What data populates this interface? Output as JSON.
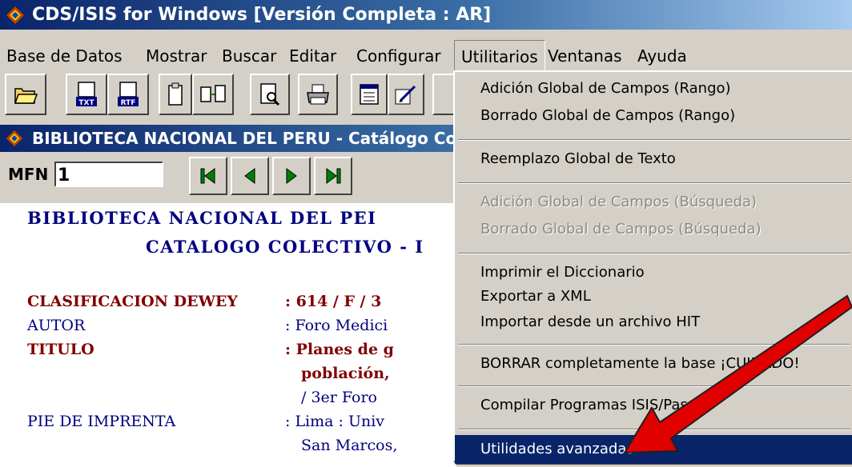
{
  "window": {
    "title": "CDS/ISIS for Windows [Versión Completa : AR]"
  },
  "menubar": {
    "items": [
      "Base de Datos",
      "Mostrar",
      "Buscar",
      "Editar",
      "Configurar",
      "Utilitarios",
      "Ventanas",
      "Ayuda"
    ],
    "open_item": "Utilitarios"
  },
  "toolbar": {
    "buttons": [
      {
        "icon": "open-folder-icon",
        "label": ""
      },
      {
        "icon": "export-txt-icon",
        "label": "TXT"
      },
      {
        "icon": "export-rtf-icon",
        "label": "RTF"
      },
      {
        "icon": "clipboard-icon",
        "label": ""
      },
      {
        "icon": "copy-record-icon",
        "label": ""
      },
      {
        "icon": "print-preview-icon",
        "label": ""
      },
      {
        "icon": "print-icon",
        "label": ""
      },
      {
        "icon": "form-icon",
        "label": ""
      },
      {
        "icon": "edit-pen-icon",
        "label": ""
      }
    ]
  },
  "child_window": {
    "title": "BIBLIOTECA NACIONAL DEL PERU - Catálogo Co",
    "mfn_label": "MFN",
    "mfn_value": "1",
    "nav": [
      "first-record-icon",
      "previous-record-icon",
      "next-record-icon",
      "last-record-icon"
    ],
    "record": {
      "header1": "BIBLIOTECA NACIONAL DEL PEI",
      "header2": "CATALOGO COLECTIVO - I",
      "fields": [
        {
          "label": "CLASIFICACION DEWEY",
          "value": ": 614 / F / 3"
        },
        {
          "label": "AUTOR",
          "value": ": Foro Medici"
        },
        {
          "label": "TITULO",
          "value": ": Planes de g"
        },
        {
          "label": "",
          "value": "población,"
        },
        {
          "label": "",
          "value": "/ 3er Foro"
        },
        {
          "label": "PIE DE IMPRENTA",
          "value": ": Lima : Univ"
        },
        {
          "label": "",
          "value": "San Marcos,"
        }
      ]
    }
  },
  "dropdown": {
    "items": [
      {
        "label": "Adición Global de Campos (Rango)",
        "enabled": true
      },
      {
        "label": "Borrado Global de Campos (Rango)",
        "enabled": true
      },
      {
        "label": "Reemplazo Global de Texto",
        "enabled": true
      },
      {
        "label": "Adición Global de Campos (Búsqueda)",
        "enabled": false
      },
      {
        "label": "Borrado Global de Campos (Búsqueda)",
        "enabled": false
      },
      {
        "label": "Imprimir el Diccionario",
        "enabled": true
      },
      {
        "label": "Exportar a XML",
        "enabled": true
      },
      {
        "label": "Importar desde un archivo HIT",
        "enabled": true
      },
      {
        "label": "BORRAR completamente la base ¡CUIDADO!",
        "enabled": true
      },
      {
        "label": "Compilar Programas ISIS/Pascal",
        "enabled": true
      },
      {
        "label": "Utilidades avanzadas",
        "enabled": true,
        "highlighted": true
      }
    ]
  },
  "colors": {
    "titlebar": "#0a246a",
    "highlight": "#0a246a",
    "arrow": "#e00000",
    "record_blue": "#000080",
    "record_red": "#800000"
  }
}
